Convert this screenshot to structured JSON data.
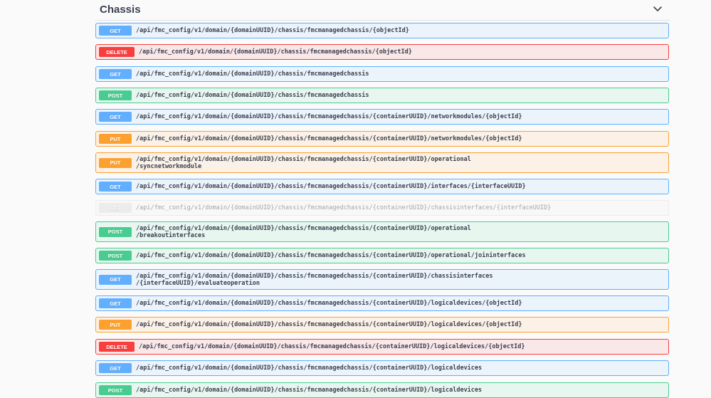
{
  "section": {
    "title": "Chassis",
    "toggle_icon": "chevron-down-icon"
  },
  "operations": [
    {
      "method": "GET",
      "path": "/api/fmc_config/v1/domain/{domainUUID}/chassis/fmcmanagedchassis/{objectId}"
    },
    {
      "method": "DELETE",
      "path": "/api/fmc_config/v1/domain/{domainUUID}/chassis/fmcmanagedchassis/{objectId}"
    },
    {
      "method": "GET",
      "path": "/api/fmc_config/v1/domain/{domainUUID}/chassis/fmcmanagedchassis"
    },
    {
      "method": "POST",
      "path": "/api/fmc_config/v1/domain/{domainUUID}/chassis/fmcmanagedchassis"
    },
    {
      "method": "GET",
      "path": "/api/fmc_config/v1/domain/{domainUUID}/chassis/fmcmanagedchassis/{containerUUID}/networkmodules/{objectId}"
    },
    {
      "method": "PUT",
      "path": "/api/fmc_config/v1/domain/{domainUUID}/chassis/fmcmanagedchassis/{containerUUID}/networkmodules/{objectId}"
    },
    {
      "method": "PUT",
      "path": "/api/fmc_config/v1/domain/{domainUUID}/chassis/fmcmanagedchassis/{containerUUID}/operational\n/syncnetworkmodule"
    },
    {
      "method": "GET",
      "path": "/api/fmc_config/v1/domain/{domainUUID}/chassis/fmcmanagedchassis/{containerUUID}/interfaces/{interfaceUUID}"
    },
    {
      "method": "GET",
      "path": "/api/fmc_config/v1/domain/{domainUUID}/chassis/fmcmanagedchassis/{containerUUID}/chassisinterfaces/{interfaceUUID}",
      "faded": true
    },
    {
      "method": "POST",
      "path": "/api/fmc_config/v1/domain/{domainUUID}/chassis/fmcmanagedchassis/{containerUUID}/operational\n/breakoutinterfaces"
    },
    {
      "method": "POST",
      "path": "/api/fmc_config/v1/domain/{domainUUID}/chassis/fmcmanagedchassis/{containerUUID}/operational/joininterfaces"
    },
    {
      "method": "GET",
      "path": "/api/fmc_config/v1/domain/{domainUUID}/chassis/fmcmanagedchassis/{containerUUID}/chassisinterfaces\n/{interfaceUUID}/evaluateoperation"
    },
    {
      "method": "GET",
      "path": "/api/fmc_config/v1/domain/{domainUUID}/chassis/fmcmanagedchassis/{containerUUID}/logicaldevices/{objectId}"
    },
    {
      "method": "PUT",
      "path": "/api/fmc_config/v1/domain/{domainUUID}/chassis/fmcmanagedchassis/{containerUUID}/logicaldevices/{objectId}"
    },
    {
      "method": "DELETE",
      "path": "/api/fmc_config/v1/domain/{domainUUID}/chassis/fmcmanagedchassis/{containerUUID}/logicaldevices/{objectId}"
    },
    {
      "method": "GET",
      "path": "/api/fmc_config/v1/domain/{domainUUID}/chassis/fmcmanagedchassis/{containerUUID}/logicaldevices"
    },
    {
      "method": "POST",
      "path": "/api/fmc_config/v1/domain/{domainUUID}/chassis/fmcmanagedchassis/{containerUUID}/logicaldevices"
    }
  ]
}
